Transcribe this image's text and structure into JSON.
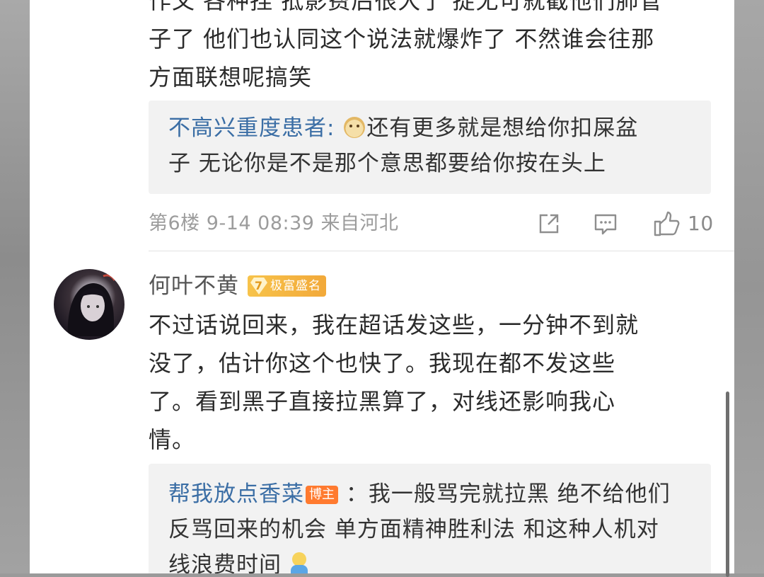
{
  "comment1": {
    "text_lines": [
      "作文 各种捏 抵影费后很大了 捉无可就截他们肺管",
      "子了 他们也认同这个说法就爆炸了 不然谁会往那",
      "方面联想呢搞笑"
    ],
    "reply": {
      "user": "不高兴重度患者",
      "colon": ":",
      "emoji": "doge-emoji",
      "text_line1": "还有更多就是想给你扣屎盆",
      "text_line2": "子 无论你是不是那个意思都要给你按在头上"
    },
    "meta": {
      "floor": "第6楼",
      "datetime": "9-14 08:39",
      "location": "来自河北",
      "like_count": "10"
    },
    "icons": {
      "share": "share-icon",
      "comment": "comment-icon",
      "like": "thumbs-up-icon"
    }
  },
  "comment2": {
    "username": "何叶不黄",
    "badge_level": "7",
    "badge_label": "极富盛名",
    "text_lines": [
      "不过话说回来，我在超话发这些，一分钟不到就",
      "没了，估计你这个也快了。我现在都不发这些",
      "了。看到黑子直接拉黑算了，对线还影响我心",
      "情。"
    ],
    "reply": {
      "user": "帮我放点香菜",
      "host_tag": "博主",
      "text_line1": "：我一般骂完就拉黑 绝不给他们",
      "text_line2": "反骂回来的机会 单方面精神胜利法 和这种人机对",
      "text_line3": "线浪费时间"
    }
  },
  "colors": {
    "link_blue": "#3b6ea5",
    "badge_gold": "#f2a93a",
    "host_orange": "#ff7a2f",
    "meta_gray": "#9c9c9c"
  }
}
